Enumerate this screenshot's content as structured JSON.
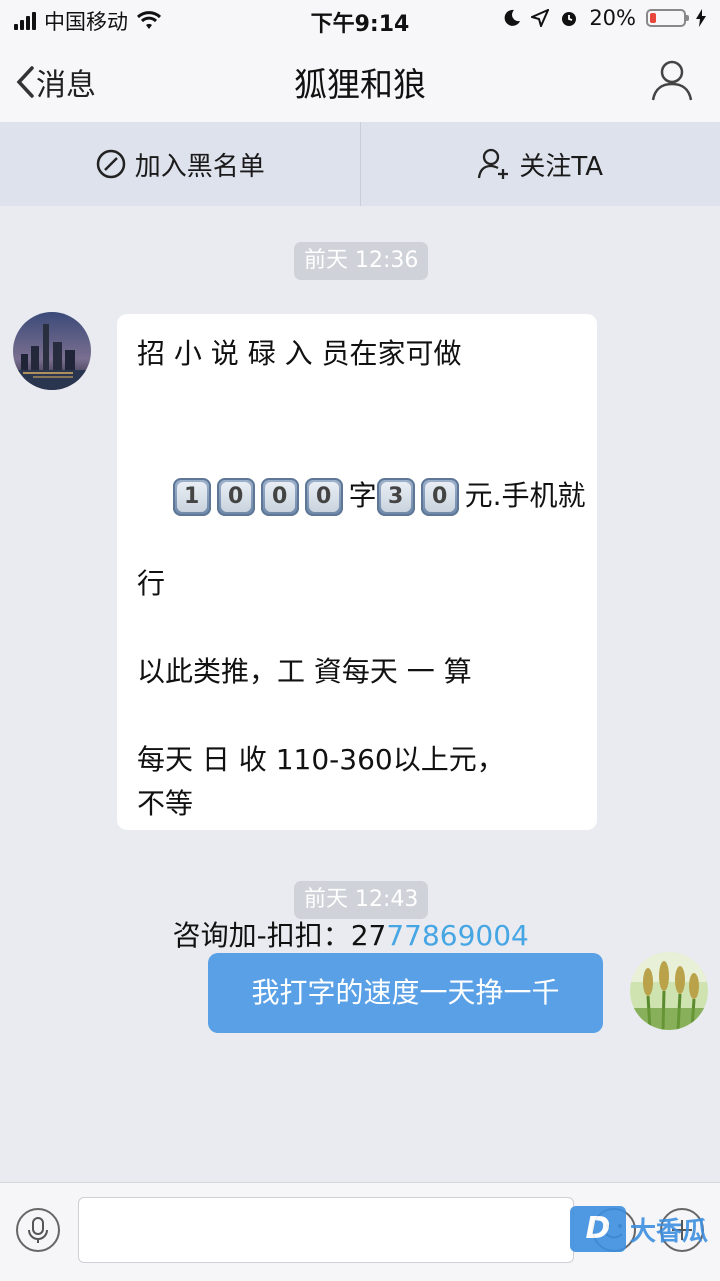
{
  "status_bar": {
    "carrier": "中国移动",
    "time": "下午9:14",
    "battery_percent": "20%",
    "battery_level": 0.2
  },
  "nav": {
    "back_label": "消息",
    "title": "狐狸和狼",
    "icons": {
      "back": "chevron-left-icon",
      "profile": "person-icon"
    }
  },
  "actions": {
    "blacklist_label": "加入黑名单",
    "follow_label": "关注TA"
  },
  "messages": [
    {
      "time": "前天 12:36",
      "direction": "incoming",
      "lines": {
        "l1": "招 小 说 碌 入 员在家可做",
        "l2_keys_a": [
          "1",
          "0",
          "0",
          "0"
        ],
        "l2_word_a": "字",
        "l2_keys_b": [
          "3",
          "0"
        ],
        "l2_tail": "元.手机就",
        "l3": "行",
        "l4": "以此类推，工 資每天 一 算",
        "l5": "每天 日 收 110-360以上元，",
        "l6": "不等",
        "l7_prefix": "咨询加-扣扣：27",
        "l7_link": "77869004"
      }
    },
    {
      "time": "前天 12:43",
      "direction": "outgoing",
      "text": "我打字的速度一天挣一千"
    }
  ],
  "input": {
    "placeholder": "",
    "icons": {
      "mic": "microphone-icon",
      "emoji": "smiley-icon",
      "plus": "plus-icon"
    }
  },
  "watermark": {
    "logo": "D",
    "text": "大香瓜"
  },
  "colors": {
    "outgoing_bubble": "#5aa0e6",
    "link": "#46a6e4",
    "battery_low": "#e8463c",
    "action_bar": "#dde2ec"
  }
}
